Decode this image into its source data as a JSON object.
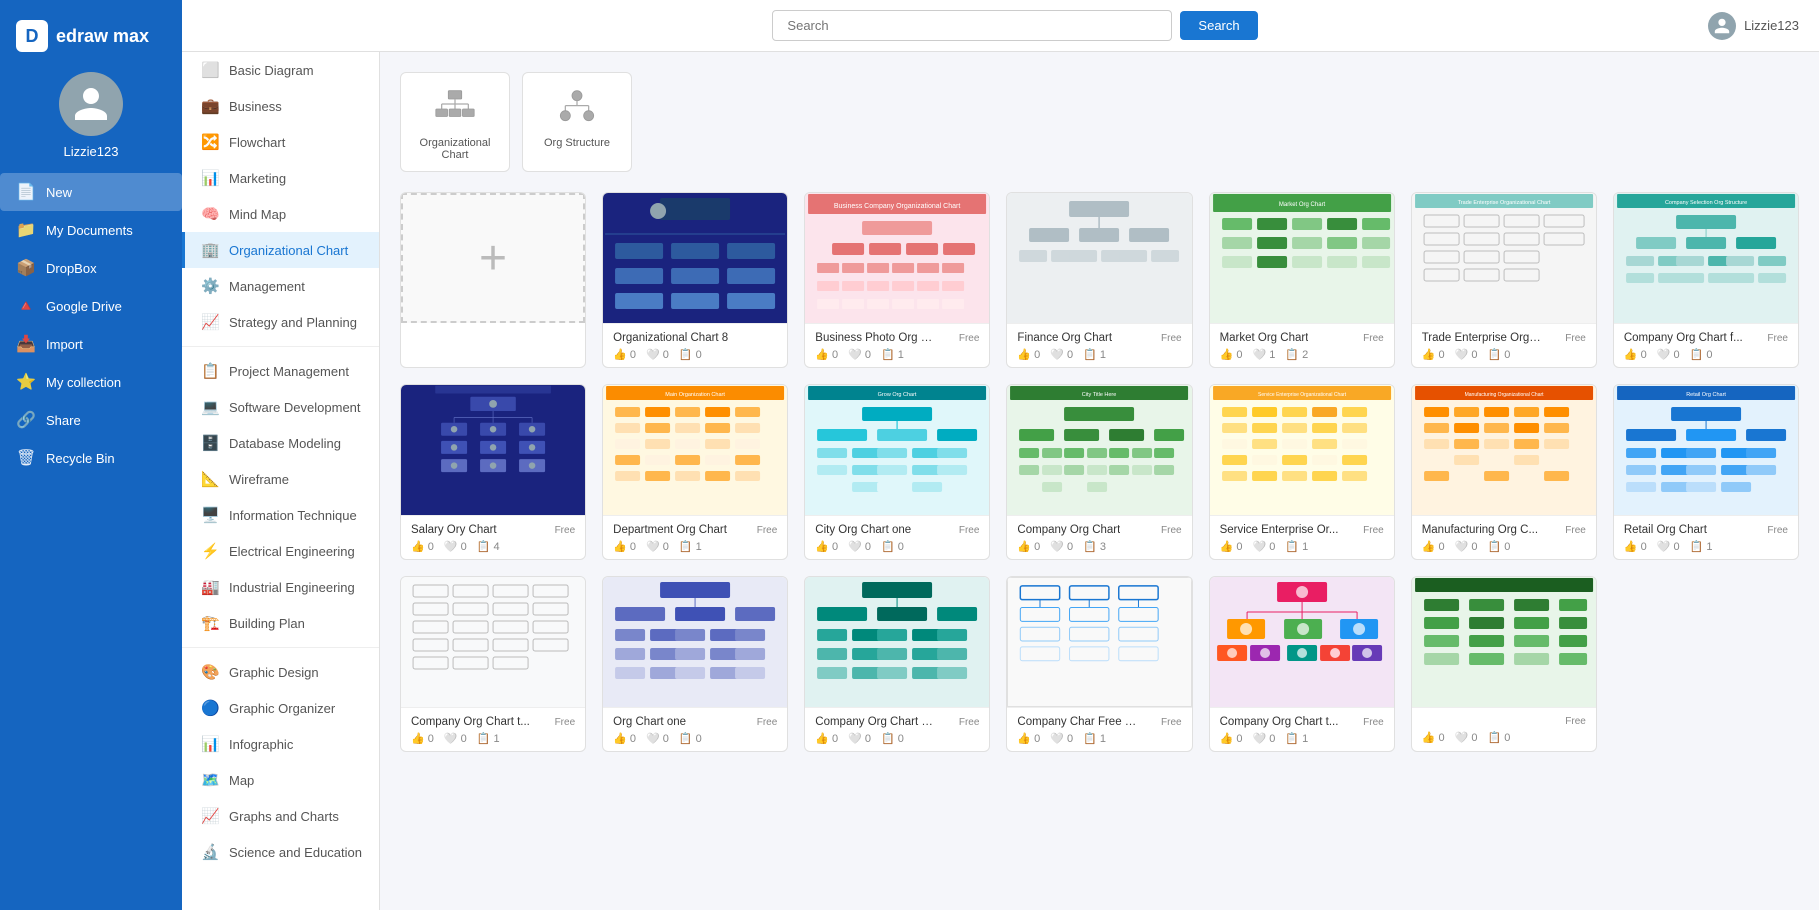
{
  "app": {
    "name": "edraw max",
    "logo_letter": "D"
  },
  "user": {
    "name": "Lizzie123"
  },
  "topbar": {
    "search_placeholder": "Search",
    "search_button": "Search"
  },
  "sidebar_nav": [
    {
      "id": "new",
      "label": "New",
      "icon": "📄",
      "active": true
    },
    {
      "id": "my-documents",
      "label": "My Documents",
      "icon": "📁",
      "active": false
    },
    {
      "id": "dropbox",
      "label": "DropBox",
      "icon": "📦",
      "active": false
    },
    {
      "id": "google-drive",
      "label": "Google Drive",
      "icon": "🔺",
      "active": false
    },
    {
      "id": "import",
      "label": "Import",
      "icon": "📥",
      "active": false
    },
    {
      "id": "my-collection",
      "label": "My collection",
      "icon": "⭐",
      "active": false
    },
    {
      "id": "share",
      "label": "Share",
      "icon": "🔗",
      "active": false
    },
    {
      "id": "recycle-bin",
      "label": "Recycle Bin",
      "icon": "🗑",
      "active": false
    }
  ],
  "categories": [
    {
      "id": "basic-diagram",
      "label": "Basic Diagram",
      "icon": "⬜",
      "active": false
    },
    {
      "id": "business",
      "label": "Business",
      "icon": "💼",
      "active": false
    },
    {
      "id": "flowchart",
      "label": "Flowchart",
      "icon": "🔀",
      "active": false
    },
    {
      "id": "marketing",
      "label": "Marketing",
      "icon": "📊",
      "active": false
    },
    {
      "id": "mind-map",
      "label": "Mind Map",
      "icon": "🧠",
      "active": false
    },
    {
      "id": "org-chart",
      "label": "Organizational Chart",
      "icon": "🏢",
      "active": true
    },
    {
      "id": "management",
      "label": "Management",
      "icon": "⚙️",
      "active": false
    },
    {
      "id": "strategy",
      "label": "Strategy and Planning",
      "icon": "📈",
      "active": false
    },
    {
      "id": "project-mgmt",
      "label": "Project Management",
      "icon": "📋",
      "active": false
    },
    {
      "id": "software-dev",
      "label": "Software Development",
      "icon": "💻",
      "active": false
    },
    {
      "id": "database",
      "label": "Database Modeling",
      "icon": "🗄️",
      "active": false
    },
    {
      "id": "wireframe",
      "label": "Wireframe",
      "icon": "📐",
      "active": false
    },
    {
      "id": "info-tech",
      "label": "Information Technique",
      "icon": "🖥️",
      "active": false
    },
    {
      "id": "electrical",
      "label": "Electrical Engineering",
      "icon": "⚡",
      "active": false
    },
    {
      "id": "industrial",
      "label": "Industrial Engineering",
      "icon": "🏭",
      "active": false
    },
    {
      "id": "building",
      "label": "Building Plan",
      "icon": "🏗️",
      "active": false
    },
    {
      "id": "graphic-design",
      "label": "Graphic Design",
      "icon": "🎨",
      "active": false
    },
    {
      "id": "graphic-organizer",
      "label": "Graphic Organizer",
      "icon": "🔵",
      "active": false
    },
    {
      "id": "infographic",
      "label": "Infographic",
      "icon": "📊",
      "active": false
    },
    {
      "id": "map",
      "label": "Map",
      "icon": "🗺️",
      "active": false
    },
    {
      "id": "graphs-charts",
      "label": "Graphs and Charts",
      "icon": "📈",
      "active": false
    },
    {
      "id": "science",
      "label": "Science and Education",
      "icon": "🔬",
      "active": false
    }
  ],
  "type_cards": [
    {
      "id": "org-chart-type",
      "label": "Organizational Chart"
    },
    {
      "id": "org-structure-type",
      "label": "Org Structure"
    }
  ],
  "templates": [
    {
      "id": "add-new",
      "type": "add-new",
      "title": "",
      "badge": "",
      "likes": "",
      "hearts": "",
      "copies": ""
    },
    {
      "id": "org-chart-8",
      "type": "template",
      "title": "Organizational Chart 8",
      "badge": "",
      "likes": "0",
      "hearts": "0",
      "copies": "0",
      "thumb_color": "blue_dark"
    },
    {
      "id": "business-photo",
      "type": "template",
      "title": "Business Photo Org C...",
      "badge": "Free",
      "likes": "0",
      "hearts": "0",
      "copies": "1",
      "thumb_color": "pink"
    },
    {
      "id": "finance-org",
      "type": "template",
      "title": "Finance Org Chart",
      "badge": "Free",
      "likes": "0",
      "hearts": "0",
      "copies": "1",
      "thumb_color": "gray"
    },
    {
      "id": "salary-ory",
      "type": "template",
      "title": "Salary Ory Chart",
      "badge": "Free",
      "likes": "0",
      "hearts": "0",
      "copies": "4",
      "thumb_color": "dark_blue"
    },
    {
      "id": "market-org",
      "type": "template",
      "title": "Market Org Chart",
      "badge": "Free",
      "likes": "0",
      "hearts": "1",
      "copies": "2",
      "thumb_color": "green"
    },
    {
      "id": "trade-enterprise",
      "type": "template",
      "title": "Trade Enterprise Org ...",
      "badge": "Free",
      "likes": "0",
      "hearts": "0",
      "copies": "0",
      "thumb_color": "teal_light"
    },
    {
      "id": "company-org-f",
      "type": "template",
      "title": "Company Org Chart f...",
      "badge": "Free",
      "likes": "0",
      "hearts": "0",
      "copies": "0",
      "thumb_color": "teal"
    },
    {
      "id": "department-org",
      "type": "template",
      "title": "Department Org Chart",
      "badge": "Free",
      "likes": "0",
      "hearts": "0",
      "copies": "1",
      "thumb_color": "multi"
    },
    {
      "id": "city-org-one",
      "type": "template",
      "title": "City Org Chart one",
      "badge": "Free",
      "likes": "0",
      "hearts": "0",
      "copies": "0",
      "thumb_color": "teal2"
    },
    {
      "id": "company-org",
      "type": "template",
      "title": "Company Org Chart",
      "badge": "Free",
      "likes": "0",
      "hearts": "0",
      "copies": "3",
      "thumb_color": "teal3"
    },
    {
      "id": "service-enterprise",
      "type": "template",
      "title": "Service Enterprise Or...",
      "badge": "Free",
      "likes": "0",
      "hearts": "0",
      "copies": "1",
      "thumb_color": "yellow_warm"
    },
    {
      "id": "manufacturing-org",
      "type": "template",
      "title": "Manufacturing Org C...",
      "badge": "Free",
      "likes": "0",
      "hearts": "0",
      "copies": "0",
      "thumb_color": "peach"
    },
    {
      "id": "retail-org",
      "type": "template",
      "title": "Retail Org Chart",
      "badge": "Free",
      "likes": "0",
      "hearts": "0",
      "copies": "1",
      "thumb_color": "blue_teal"
    },
    {
      "id": "company-org-t",
      "type": "template",
      "title": "Company Org Chart t...",
      "badge": "Free",
      "likes": "0",
      "hearts": "0",
      "copies": "1",
      "thumb_color": "light_gray"
    },
    {
      "id": "org-chart-one",
      "type": "template",
      "title": "Org Chart one",
      "badge": "Free",
      "likes": "0",
      "hearts": "0",
      "copies": "0",
      "thumb_color": "blue_nav"
    },
    {
      "id": "company-org-chart-free",
      "type": "template",
      "title": "Company Org Chart Free",
      "badge": "Free",
      "likes": "0",
      "hearts": "0",
      "copies": "0",
      "thumb_color": "teal4"
    },
    {
      "id": "company-char-free",
      "type": "template",
      "title": "Company Char Free Org",
      "badge": "Free",
      "likes": "0",
      "hearts": "0",
      "copies": "1",
      "thumb_color": "white_border"
    },
    {
      "id": "company-org-chart-t2",
      "type": "template",
      "title": "Company Org Chart t...",
      "badge": "Free",
      "likes": "0",
      "hearts": "0",
      "copies": "1",
      "thumb_color": "colorful"
    },
    {
      "id": "extra1",
      "type": "template",
      "title": "",
      "badge": "Free",
      "likes": "0",
      "hearts": "0",
      "copies": "0",
      "thumb_color": "teal5"
    }
  ]
}
